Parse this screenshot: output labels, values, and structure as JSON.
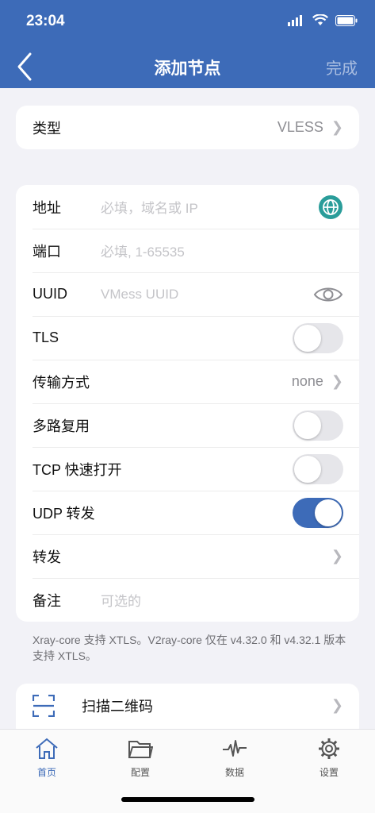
{
  "status": {
    "time": "23:04"
  },
  "nav": {
    "title": "添加节点",
    "done": "完成"
  },
  "type_row": {
    "label": "类型",
    "value": "VLESS"
  },
  "form": {
    "address": {
      "label": "地址",
      "placeholder": "必填，域名或 IP"
    },
    "port": {
      "label": "端口",
      "placeholder": "必填, 1-65535"
    },
    "uuid": {
      "label": "UUID",
      "placeholder": "VMess UUID"
    },
    "tls": {
      "label": "TLS",
      "on": false
    },
    "transport": {
      "label": "传输方式",
      "value": "none"
    },
    "mux": {
      "label": "多路复用",
      "on": false
    },
    "tcp_fast_open": {
      "label": "TCP 快速打开",
      "on": false
    },
    "udp_relay": {
      "label": "UDP 转发",
      "on": true
    },
    "forward": {
      "label": "转发"
    },
    "remark": {
      "label": "备注",
      "placeholder": "可选的"
    }
  },
  "note": "Xray-core 支持 XTLS。V2ray-core 仅在 v4.32.0 和 v4.32.1 版本支持 XTLS。",
  "scan": {
    "label": "扫描二维码"
  },
  "tabs": [
    {
      "label": "首页",
      "icon": "home-icon",
      "active": true
    },
    {
      "label": "配置",
      "icon": "folder-icon",
      "active": false
    },
    {
      "label": "数据",
      "icon": "pulse-icon",
      "active": false
    },
    {
      "label": "设置",
      "icon": "gear-icon",
      "active": false
    }
  ],
  "colors": {
    "accent": "#3d6bb8",
    "globe": "#2a9d9a"
  }
}
